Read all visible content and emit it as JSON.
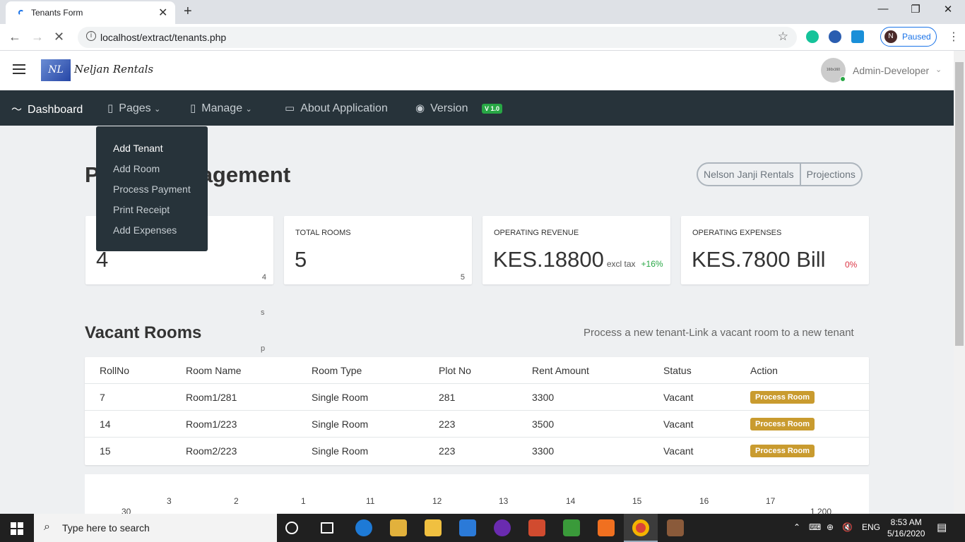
{
  "browser": {
    "tab_title": "Tenants Form",
    "url": "localhost/extract/tenants.php",
    "profile_initial": "N",
    "profile_status": "Paused",
    "win_minimize": "—",
    "win_restore": "❐",
    "win_close": "✕"
  },
  "app": {
    "logo_text": "NL",
    "brand": "Neljan Rentals",
    "avatar_text": "160x160",
    "user_name": "Admin-Developer"
  },
  "nav": {
    "dashboard": "Dashboard",
    "pages": "Pages",
    "manage": "Manage",
    "about": "About Application",
    "version": "Version",
    "version_badge": "V 1.0"
  },
  "dropdown": {
    "items": [
      "Add Tenant",
      "Add Room",
      "Process Payment",
      "Print Receipt",
      "Add Expenses"
    ]
  },
  "page": {
    "title_left": "P",
    "title_right": "agement",
    "btn1": "Nelson Janji Rentals",
    "btn2": "Projections"
  },
  "cards": [
    {
      "title": "",
      "value": "4",
      "sub": "4"
    },
    {
      "title": "TOTAL ROOMS",
      "value": "5",
      "sub": "5"
    },
    {
      "title": "OPERATING REVENUE",
      "value": "KES.18800",
      "suffix": "excl tax",
      "pct": "+16%",
      "pct_color": "#28a745"
    },
    {
      "title": "OPERATING EXPENSES",
      "value": "KES.7800 Bill",
      "pct": "0%",
      "pct_color": "#dc3545"
    }
  ],
  "stray": {
    "s": "s",
    "p": "p"
  },
  "vacant": {
    "title": "Vacant Rooms",
    "help": "Process a new tenant-Link a vacant room to a new tenant",
    "headers": [
      "RollNo",
      "Room Name",
      "Room Type",
      "Plot No",
      "Rent Amount",
      "Status",
      "Action"
    ],
    "rows": [
      [
        "7",
        "Room1/281",
        "Single Room",
        "281",
        "3300",
        "Vacant",
        "Process Room"
      ],
      [
        "14",
        "Room1/223",
        "Single Room",
        "223",
        "3500",
        "Vacant",
        "Process Room"
      ],
      [
        "15",
        "Room2/223",
        "Single Room",
        "223",
        "3300",
        "Vacant",
        "Process Room"
      ]
    ]
  },
  "chart_labels": [
    "3",
    "2",
    "1",
    "11",
    "12",
    "13",
    "14",
    "15",
    "16",
    "17"
  ],
  "chart_left": "30",
  "chart_right": "1 200",
  "taskbar": {
    "search_placeholder": "Type here to search",
    "lang": "ENG",
    "time": "8:53 AM",
    "date": "5/16/2020"
  }
}
